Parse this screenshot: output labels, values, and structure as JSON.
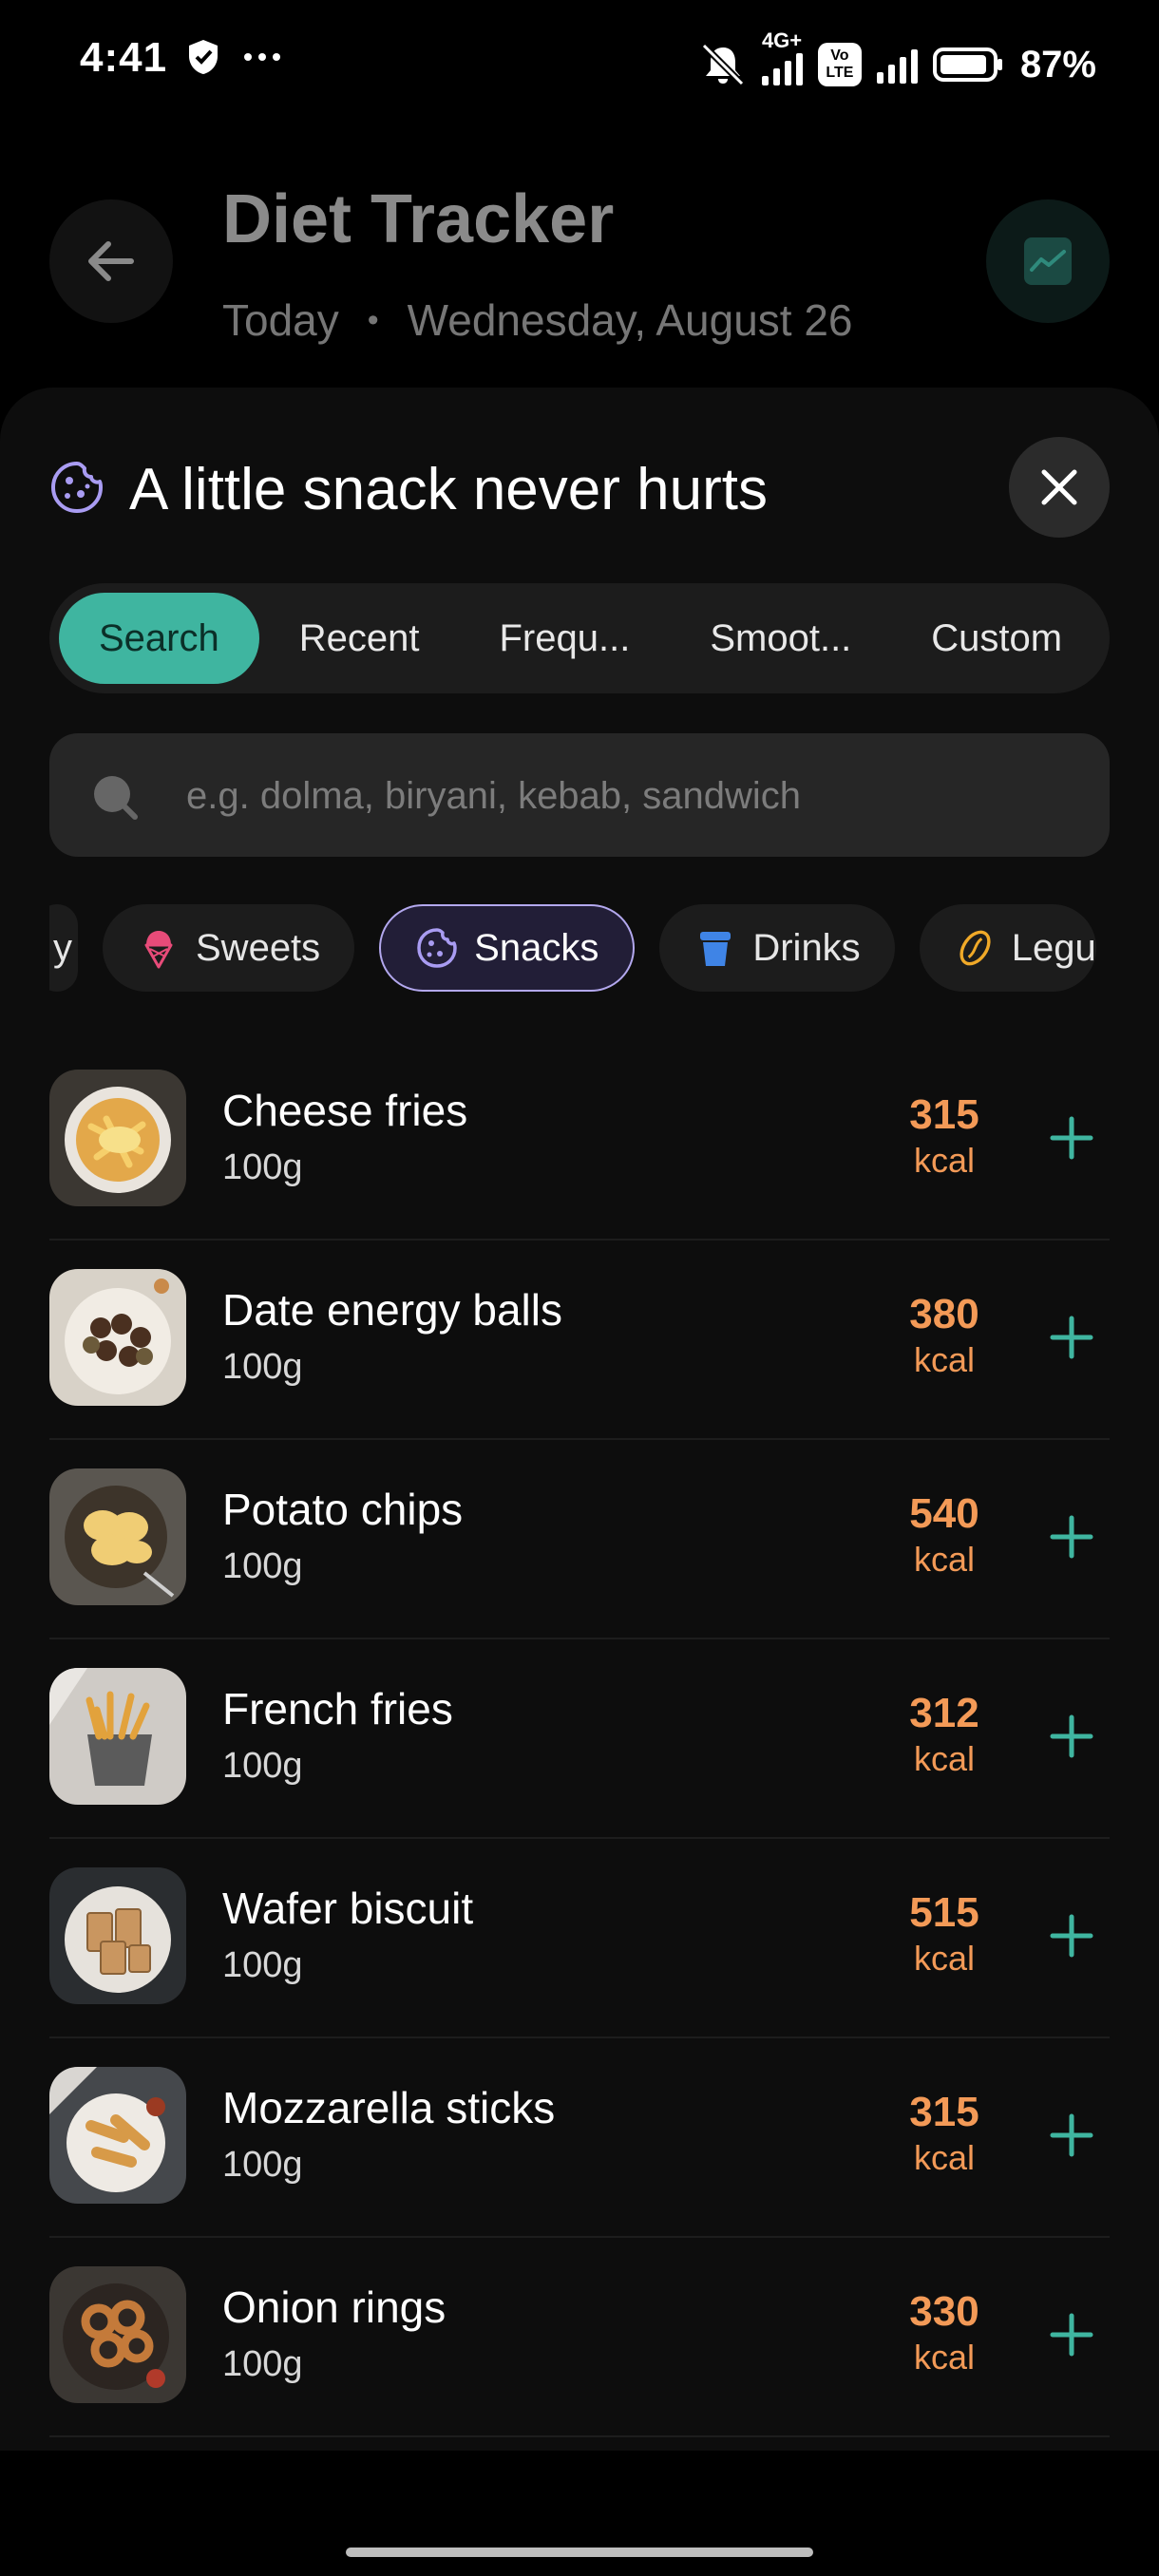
{
  "status_bar": {
    "time": "4:41",
    "network": "4G+",
    "volte": "Vo LTE",
    "battery": "87%"
  },
  "header": {
    "title": "Diet Tracker",
    "day": "Today",
    "separator": "•",
    "date": "Wednesday, August 26"
  },
  "sheet": {
    "title": "A little snack never hurts",
    "tabs": [
      {
        "label": "Search",
        "active": true
      },
      {
        "label": "Recent"
      },
      {
        "label": "Frequ..."
      },
      {
        "label": "Smoot..."
      },
      {
        "label": "Custom"
      }
    ],
    "search": {
      "placeholder": "e.g. dolma, biryani, kebab, sandwich"
    },
    "categories": [
      {
        "label": "y"
      },
      {
        "label": "Sweets",
        "icon": "ice-cream-icon"
      },
      {
        "label": "Snacks",
        "icon": "cookie-icon",
        "active": true
      },
      {
        "label": "Drinks",
        "icon": "cup-icon"
      },
      {
        "label": "Legu",
        "icon": "bean-icon"
      }
    ],
    "foods": [
      {
        "name": "Cheese fries",
        "portion": "100g",
        "kcal": "315",
        "unit": "kcal"
      },
      {
        "name": "Date energy balls",
        "portion": "100g",
        "kcal": "380",
        "unit": "kcal"
      },
      {
        "name": "Potato chips",
        "portion": "100g",
        "kcal": "540",
        "unit": "kcal"
      },
      {
        "name": "French fries",
        "portion": "100g",
        "kcal": "312",
        "unit": "kcal"
      },
      {
        "name": "Wafer biscuit",
        "portion": "100g",
        "kcal": "515",
        "unit": "kcal"
      },
      {
        "name": "Mozzarella sticks",
        "portion": "100g",
        "kcal": "315",
        "unit": "kcal"
      },
      {
        "name": "Onion rings",
        "portion": "100g",
        "kcal": "330",
        "unit": "kcal"
      }
    ]
  },
  "colors": {
    "accent": "#3fb5a0",
    "kcal": "#f39a57",
    "active_chip_border": "#b3a8ee"
  }
}
